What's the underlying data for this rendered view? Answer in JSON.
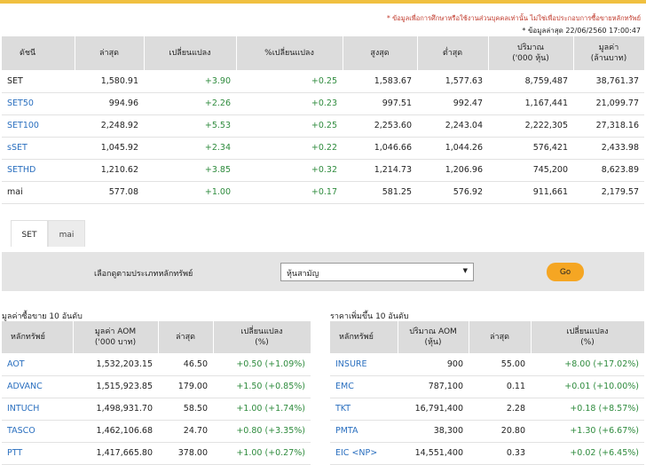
{
  "disclaimer": "* ข้อมูลเพื่อการศึกษาหรือใช้งานส่วนบุคคลเท่านั้น ไม่ใช่เพื่อประกอบการซื้อขายหลักทรัพย์",
  "data_as_of": "* ข้อมูลล่าสุด 22/06/2560 17:00:47",
  "index_table": {
    "headers": [
      "ดัชนี",
      "ล่าสุด",
      "เปลี่ยนแปลง",
      "%เปลี่ยนแปลง",
      "สูงสุด",
      "ต่ำสุด",
      "ปริมาณ\n('000 หุ้น)",
      "มูลค่า\n(ล้านบาท)"
    ],
    "rows": [
      {
        "name": "SET",
        "last": "1,580.91",
        "change": "+3.90",
        "pct": "+0.25",
        "high": "1,583.67",
        "low": "1,577.63",
        "volume": "8,759,487",
        "value": "38,761.37"
      },
      {
        "name": "SET50",
        "last": "994.96",
        "change": "+2.26",
        "pct": "+0.23",
        "high": "997.51",
        "low": "992.47",
        "volume": "1,167,441",
        "value": "21,099.77"
      },
      {
        "name": "SET100",
        "last": "2,248.92",
        "change": "+5.53",
        "pct": "+0.25",
        "high": "2,253.60",
        "low": "2,243.04",
        "volume": "2,222,305",
        "value": "27,318.16"
      },
      {
        "name": "sSET",
        "last": "1,045.92",
        "change": "+2.34",
        "pct": "+0.22",
        "high": "1,046.66",
        "low": "1,044.26",
        "volume": "576,421",
        "value": "2,433.98"
      },
      {
        "name": "SETHD",
        "last": "1,210.62",
        "change": "+3.85",
        "pct": "+0.32",
        "high": "1,214.73",
        "low": "1,206.96",
        "volume": "745,200",
        "value": "8,623.89"
      },
      {
        "name": "mai",
        "last": "577.08",
        "change": "+1.00",
        "pct": "+0.17",
        "high": "581.25",
        "low": "576.92",
        "volume": "911,661",
        "value": "2,179.57"
      }
    ]
  },
  "tabs": [
    "SET",
    "mai"
  ],
  "filter": {
    "label": "เลือกดูตามประเภทหลักทรัพย์",
    "selected": "หุ้นสามัญ",
    "go_label": "Go"
  },
  "top_value": {
    "title": "มูลค่าซื้อขาย 10 อันดับ",
    "headers": [
      "หลักทรัพย์",
      "มูลค่า AOM\n('000 บาท)",
      "ล่าสุด",
      "เปลี่ยนแปลง\n(%)"
    ],
    "rows": [
      {
        "symbol": "AOT",
        "amount": "1,532,203.15",
        "last": "46.50",
        "change": "+0.50 (+1.09%)"
      },
      {
        "symbol": "ADVANC",
        "amount": "1,515,923.85",
        "last": "179.00",
        "change": "+1.50 (+0.85%)"
      },
      {
        "symbol": "INTUCH",
        "amount": "1,498,931.70",
        "last": "58.50",
        "change": "+1.00 (+1.74%)"
      },
      {
        "symbol": "TASCO",
        "amount": "1,462,106.68",
        "last": "24.70",
        "change": "+0.80 (+3.35%)"
      },
      {
        "symbol": "PTT",
        "amount": "1,417,665.80",
        "last": "378.00",
        "change": "+1.00 (+0.27%)"
      }
    ]
  },
  "top_gainers": {
    "title": "ราคาเพิ่มขึ้น 10 อันดับ",
    "headers": [
      "หลักทรัพย์",
      "ปริมาณ AOM\n(หุ้น)",
      "ล่าสุด",
      "เปลี่ยนแปลง\n(%)"
    ],
    "rows": [
      {
        "symbol": "INSURE",
        "amount": "900",
        "last": "55.00",
        "change": "+8.00 (+17.02%)"
      },
      {
        "symbol": "EMC",
        "amount": "787,100",
        "last": "0.11",
        "change": "+0.01 (+10.00%)"
      },
      {
        "symbol": "TKT",
        "amount": "16,791,400",
        "last": "2.28",
        "change": "+0.18 (+8.57%)"
      },
      {
        "symbol": "PMTA",
        "amount": "38,300",
        "last": "20.80",
        "change": "+1.30 (+6.67%)"
      },
      {
        "symbol": "EIC <NP>",
        "amount": "14,551,400",
        "last": "0.33",
        "change": "+0.02 (+6.45%)"
      }
    ]
  },
  "colors": {
    "accent": "#f0c040",
    "link": "#2a6fbf",
    "positive": "#2e8b3d",
    "header_bg": "#dcdcdc",
    "go_button": "#f5a623"
  }
}
